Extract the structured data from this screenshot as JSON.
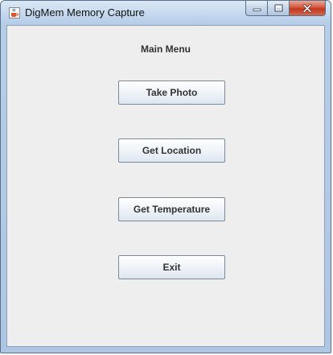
{
  "window": {
    "title": "DigMem Memory Capture"
  },
  "main_menu": {
    "title": "Main Menu",
    "buttons": [
      {
        "label": "Take Photo"
      },
      {
        "label": "Get Location"
      },
      {
        "label": "Get Temperature"
      },
      {
        "label": "Exit"
      }
    ]
  },
  "colors": {
    "titlebar": "#c4d8ee",
    "close_button": "#c2371f",
    "client_background": "#eeeeee"
  },
  "icons": {
    "app": "java-cup-icon",
    "minimize": "minimize-icon",
    "maximize": "maximize-icon",
    "close": "close-icon"
  }
}
